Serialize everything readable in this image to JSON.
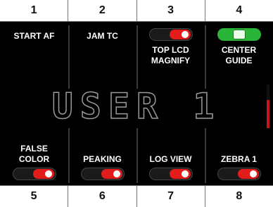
{
  "slots_top": [
    {
      "number": "1",
      "label": "START AF",
      "toggle": null
    },
    {
      "number": "2",
      "label": "JAM TC",
      "toggle": null
    },
    {
      "number": "3",
      "label": "TOP LCD\nMAGNIFY",
      "toggle": "off"
    },
    {
      "number": "4",
      "label": "CENTER\nGUIDE",
      "toggle": "on"
    }
  ],
  "slots_bottom": [
    {
      "number": "5",
      "label": "FALSE\nCOLOR",
      "toggle": "off"
    },
    {
      "number": "6",
      "label": "PEAKING",
      "toggle": "off"
    },
    {
      "number": "7",
      "label": "LOG VIEW",
      "toggle": "off"
    },
    {
      "number": "8",
      "label": "ZEBRA 1",
      "toggle": "off"
    }
  ],
  "page_title": "USER 1",
  "colors": {
    "toggle_off": "#e21b1b",
    "toggle_on": "#2ab53a",
    "scroll_thumb": "#c8151b"
  },
  "scroll": {
    "position_fraction": 1.0
  }
}
